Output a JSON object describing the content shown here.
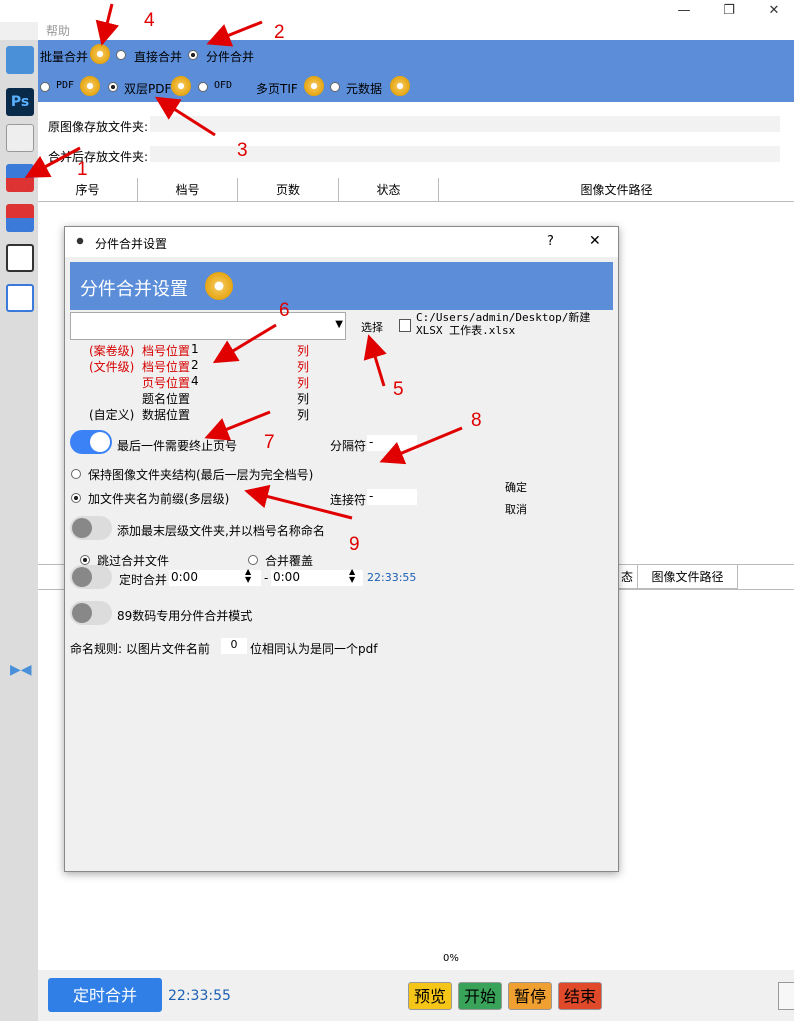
{
  "menu": {
    "help": "帮助"
  },
  "merge_mode": {
    "batch_label": "批量合并",
    "direct_label": "直接合并",
    "split_label": "分件合并"
  },
  "output_format": {
    "pdf": "PDF",
    "double_pdf": "双层PDF",
    "ofd": "OFD",
    "multi_tif": "多页TIF",
    "metadata": "元数据"
  },
  "folders": {
    "source_label": "原图像存放文件夹:",
    "target_label": "合并后存放文件夹:"
  },
  "table": {
    "columns": [
      "序号",
      "档号",
      "页数",
      "状态",
      "图像文件路径"
    ],
    "lower_columns": [
      "态",
      "图像文件路径"
    ]
  },
  "dialog": {
    "title": "分件合并设置",
    "help": "?",
    "close": "✕",
    "banner": "分件合并设置",
    "select_button": "选择",
    "file_path": "C:/Users/admin/Desktop/新建 XLSX 工作表.xlsx",
    "positions": [
      {
        "prefix": "(案卷级)",
        "label": "档号位置",
        "value": "1",
        "unit": "列",
        "red": true
      },
      {
        "prefix": "(文件级)",
        "label": "档号位置",
        "value": "2",
        "unit": "列",
        "red": true
      },
      {
        "prefix": "",
        "label": "页号位置",
        "value": "4",
        "unit": "列",
        "red": true
      },
      {
        "prefix": "",
        "label": "题名位置",
        "value": "",
        "unit": "列",
        "red": false
      },
      {
        "prefix": "(自定义)",
        "label": "数据位置",
        "value": "",
        "unit": "列",
        "red": false
      }
    ],
    "last_page_toggle": "最后一件需要终止页号",
    "separator_label": "分隔符",
    "separator_value": "-",
    "keep_structure": "保持图像文件夹结构(最后一层为完全档号)",
    "add_prefix": "加文件夹名为前缀(多层级)",
    "connector_label": "连接符",
    "connector_value": "-",
    "ok": "确定",
    "cancel": "取消",
    "add_last_folder": "添加最末层级文件夹,并以档号名称命名",
    "skip_merged": "跳过合并文件",
    "overwrite": "合并覆盖",
    "timed_merge_label": "定时合并",
    "time_from": "0:00",
    "time_sep": "-",
    "time_to": "0:00",
    "clock": "22:33:55",
    "special_mode": "89数码专用分件合并模式",
    "naming_rule_prefix": "命名规则: 以图片文件名前",
    "naming_rule_value": "0",
    "naming_rule_suffix": "位相同认为是同一个pdf"
  },
  "bottom": {
    "progress": "0%",
    "timed_merge_button": "定时合并",
    "clock": "22:33:55",
    "preview": "预览",
    "start": "开始",
    "pause": "暂停",
    "end": "结束"
  },
  "annotations": [
    "1",
    "2",
    "3",
    "4",
    "5",
    "6",
    "7",
    "8",
    "9"
  ],
  "colors": {
    "accent_blue": "#5b8dd9",
    "toggle_blue": "#3b82f6",
    "gear_yellow": "#e8a818",
    "label_red": "#d60000",
    "preview_yellow": "#f5c518",
    "start_green": "#3aa35a",
    "pause_orange": "#f0a030",
    "end_red": "#e04a2a",
    "timed_button_blue": "#2f7fe6"
  }
}
